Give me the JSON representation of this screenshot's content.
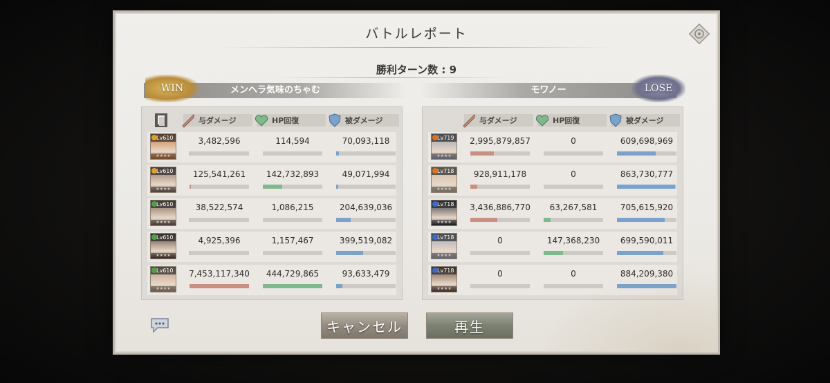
{
  "title": "バトルレポート",
  "turns_label": "勝利ターン数 : 9",
  "colors": {
    "damage": "#c98f80",
    "heal": "#7fb88c",
    "taken": "#7aa2cc",
    "win": "#c8a04a",
    "lose": "#777894"
  },
  "headers": {
    "damage": "与ダメージ",
    "heal": "HP回復",
    "taken": "被ダメージ"
  },
  "left": {
    "result": "WIN",
    "team_name": "メンヘラ気味のちゃむ",
    "units": [
      {
        "level": "Lv610",
        "damage": "3,482,596",
        "heal": "114,594",
        "taken": "70,093,118",
        "dmg_ratio": 0.003,
        "heal_ratio": 0.0,
        "taken_ratio": 0.05,
        "element_color": "#e0a030",
        "portrait": "#c8783a"
      },
      {
        "level": "Lv610",
        "damage": "125,541,261",
        "heal": "142,732,893",
        "taken": "49,071,994",
        "dmg_ratio": 0.02,
        "heal_ratio": 0.32,
        "taken_ratio": 0.04,
        "element_color": "#e0a030",
        "portrait": "#8a6a62"
      },
      {
        "level": "Lv610",
        "damage": "38,522,574",
        "heal": "1,086,215",
        "taken": "204,639,036",
        "dmg_ratio": 0.005,
        "heal_ratio": 0.0,
        "taken_ratio": 0.24,
        "element_color": "#4fa04a",
        "portrait": "#7a5e4e"
      },
      {
        "level": "Lv610",
        "damage": "4,925,396",
        "heal": "1,157,467",
        "taken": "399,519,082",
        "dmg_ratio": 0.003,
        "heal_ratio": 0.0,
        "taken_ratio": 0.45,
        "element_color": "#4fa04a",
        "portrait": "#5a4036"
      },
      {
        "level": "Lv610",
        "damage": "7,453,117,340",
        "heal": "444,729,865",
        "taken": "93,633,479",
        "dmg_ratio": 1.0,
        "heal_ratio": 1.0,
        "taken_ratio": 0.1,
        "element_color": "#4fa04a",
        "portrait": "#b89a80"
      }
    ]
  },
  "right": {
    "result": "LOSE",
    "team_name": "モワノー",
    "units": [
      {
        "level": "Lv719",
        "damage": "2,995,879,857",
        "heal": "0",
        "taken": "609,698,969",
        "dmg_ratio": 0.4,
        "heal_ratio": 0.0,
        "taken_ratio": 0.65,
        "element_color": "#e07020",
        "portrait": "#9aa0b0"
      },
      {
        "level": "Lv718",
        "damage": "928,911,178",
        "heal": "0",
        "taken": "863,730,777",
        "dmg_ratio": 0.12,
        "heal_ratio": 0.0,
        "taken_ratio": 0.98,
        "element_color": "#e07020",
        "portrait": "#c8b8a0"
      },
      {
        "level": "Lv718",
        "damage": "3,436,886,770",
        "heal": "63,267,581",
        "taken": "705,615,920",
        "dmg_ratio": 0.45,
        "heal_ratio": 0.12,
        "taken_ratio": 0.8,
        "element_color": "#3a6acc",
        "portrait": "#2c2c38"
      },
      {
        "level": "Lv718",
        "damage": "0",
        "heal": "147,368,230",
        "taken": "699,590,011",
        "dmg_ratio": 0.0,
        "heal_ratio": 0.32,
        "taken_ratio": 0.78,
        "element_color": "#3a6acc",
        "portrait": "#a0a8b8"
      },
      {
        "level": "Lv718",
        "damage": "0",
        "heal": "0",
        "taken": "884,209,380",
        "dmg_ratio": 0.0,
        "heal_ratio": 0.0,
        "taken_ratio": 1.0,
        "element_color": "#3a6acc",
        "portrait": "#6a4a3a"
      }
    ]
  },
  "buttons": {
    "cancel": "キャンセル",
    "play": "再生"
  },
  "icons": {
    "help": "help-icon",
    "copy": "copy-icon",
    "chat": "chat-icon",
    "damage": "sword-icon",
    "heal": "heart-icon",
    "taken": "shield-icon"
  }
}
